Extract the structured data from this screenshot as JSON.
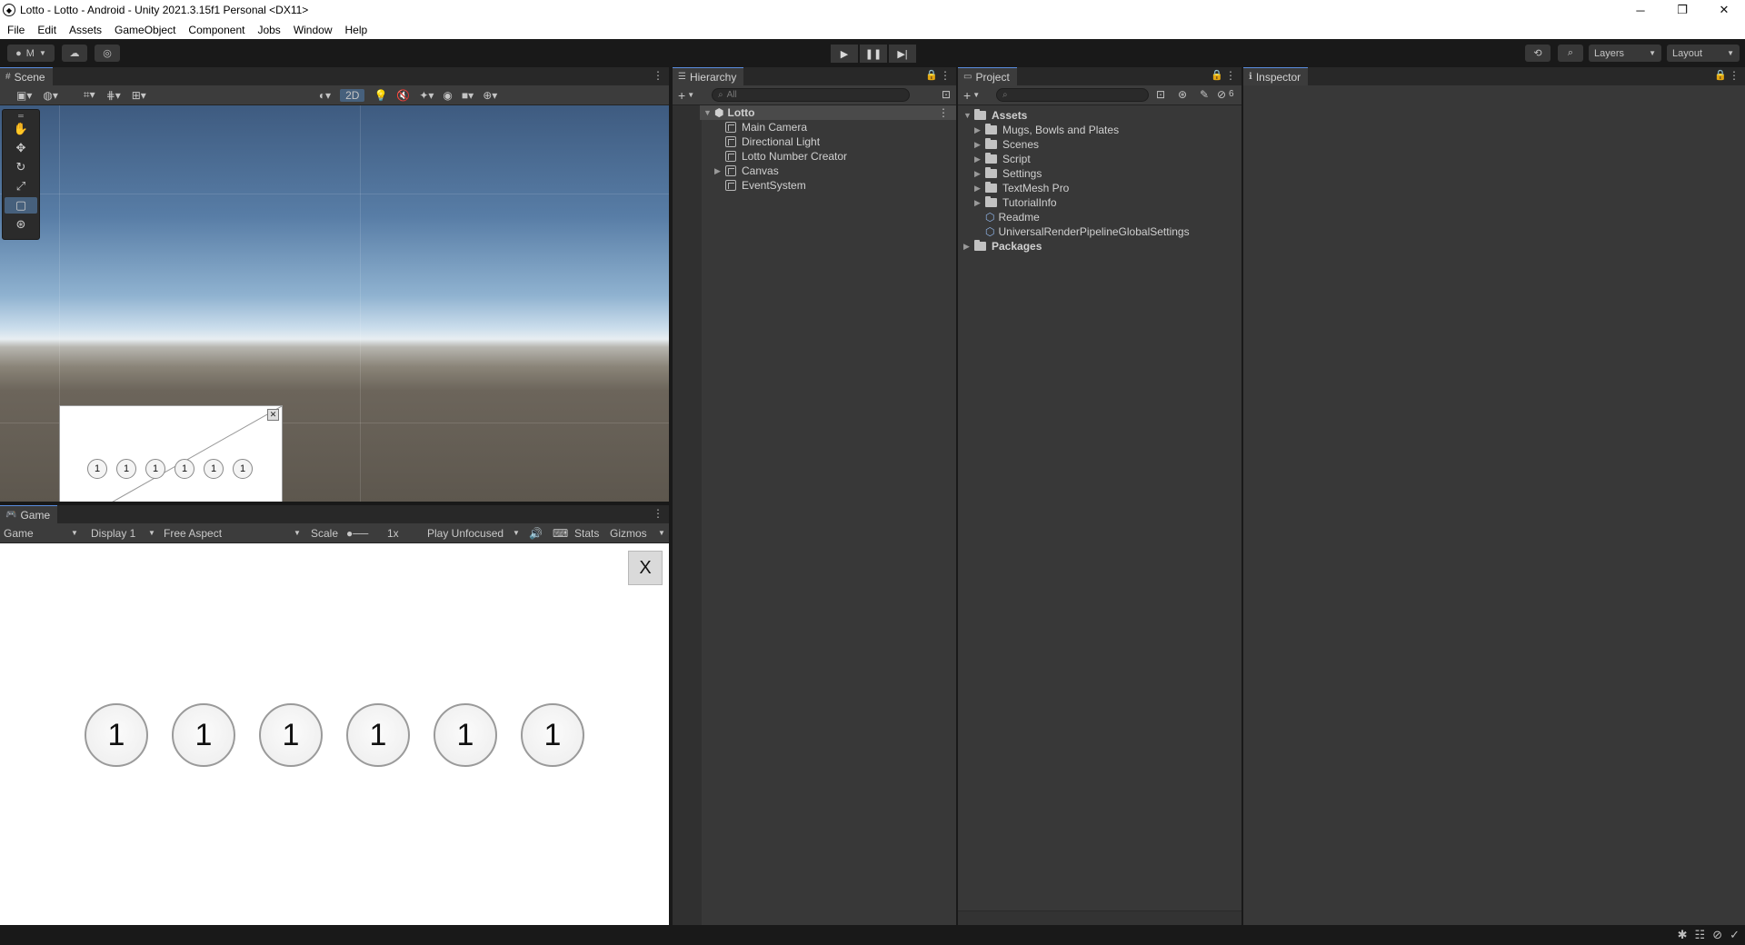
{
  "window": {
    "title": "Lotto - Lotto - Android - Unity 2021.3.15f1 Personal <DX11>"
  },
  "menu": [
    "File",
    "Edit",
    "Assets",
    "GameObject",
    "Component",
    "Jobs",
    "Window",
    "Help"
  ],
  "toolbar": {
    "account": "M",
    "layers": "Layers",
    "layout": "Layout"
  },
  "scene": {
    "tab": "Scene",
    "mode_2d": "2D",
    "ball_numbers": [
      "1",
      "1",
      "1",
      "1",
      "1",
      "1"
    ],
    "close_glyph": "✕"
  },
  "game": {
    "tab": "Game",
    "view": "Game",
    "display": "Display 1",
    "aspect": "Free Aspect",
    "scale_label": "Scale",
    "scale_value": "1x",
    "play_mode": "Play Unfocused",
    "stats": "Stats",
    "gizmos": "Gizmos",
    "close_label": "X",
    "ball_numbers": [
      "1",
      "1",
      "1",
      "1",
      "1",
      "1"
    ]
  },
  "hierarchy": {
    "tab": "Hierarchy",
    "search_placeholder": "All",
    "root": "Lotto",
    "items": [
      "Main Camera",
      "Directional Light",
      "Lotto Number Creator",
      "Canvas",
      "EventSystem"
    ]
  },
  "project": {
    "tab": "Project",
    "badge": "6",
    "assets_label": "Assets",
    "assets": [
      "Mugs, Bowls and Plates",
      "Scenes",
      "Script",
      "Settings",
      "TextMesh Pro",
      "TutorialInfo",
      "Readme",
      "UniversalRenderPipelineGlobalSettings"
    ],
    "packages_label": "Packages"
  },
  "inspector": {
    "tab": "Inspector"
  }
}
